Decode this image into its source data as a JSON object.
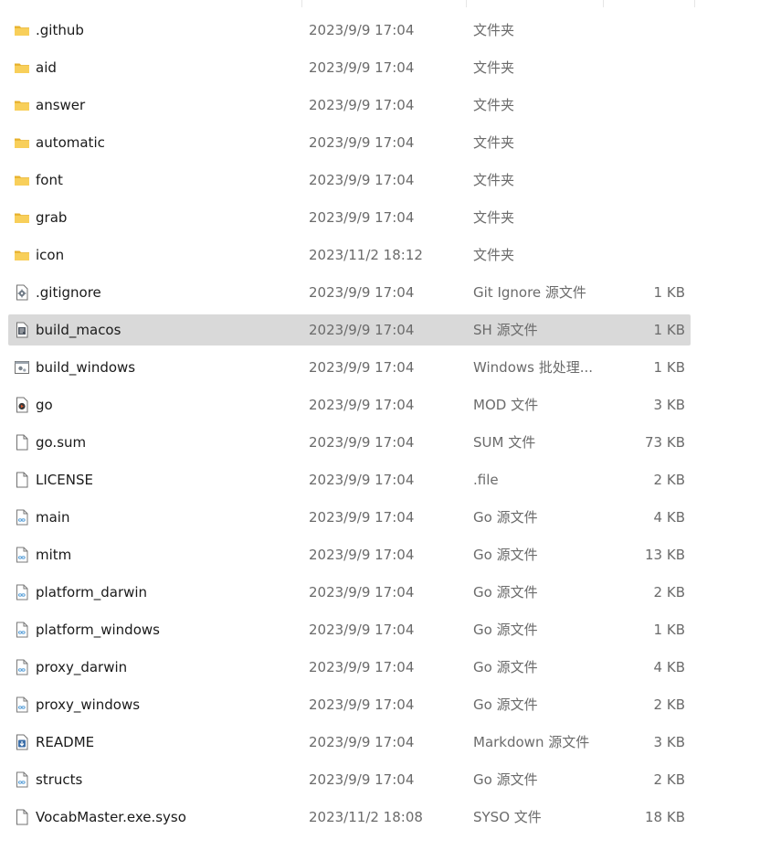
{
  "files": [
    {
      "name": ".github",
      "modified": "2023/9/9 17:04",
      "type": "文件夹",
      "size": "",
      "icon": "folder-icon",
      "selected": false
    },
    {
      "name": "aid",
      "modified": "2023/9/9 17:04",
      "type": "文件夹",
      "size": "",
      "icon": "folder-icon",
      "selected": false
    },
    {
      "name": "answer",
      "modified": "2023/9/9 17:04",
      "type": "文件夹",
      "size": "",
      "icon": "folder-icon",
      "selected": false
    },
    {
      "name": "automatic",
      "modified": "2023/9/9 17:04",
      "type": "文件夹",
      "size": "",
      "icon": "folder-icon",
      "selected": false
    },
    {
      "name": "font",
      "modified": "2023/9/9 17:04",
      "type": "文件夹",
      "size": "",
      "icon": "folder-icon",
      "selected": false
    },
    {
      "name": "grab",
      "modified": "2023/9/9 17:04",
      "type": "文件夹",
      "size": "",
      "icon": "folder-icon",
      "selected": false
    },
    {
      "name": "icon",
      "modified": "2023/11/2 18:12",
      "type": "文件夹",
      "size": "",
      "icon": "folder-icon",
      "selected": false
    },
    {
      "name": ".gitignore",
      "modified": "2023/9/9 17:04",
      "type": "Git Ignore 源文件",
      "size": "1 KB",
      "icon": "settings-file-icon",
      "selected": false
    },
    {
      "name": "build_macos",
      "modified": "2023/9/9 17:04",
      "type": "SH 源文件",
      "size": "1 KB",
      "icon": "script-file-icon",
      "selected": true
    },
    {
      "name": "build_windows",
      "modified": "2023/9/9 17:04",
      "type": "Windows 批处理...",
      "size": "1 KB",
      "icon": "batch-file-icon",
      "selected": false
    },
    {
      "name": "go",
      "modified": "2023/9/9 17:04",
      "type": "MOD 文件",
      "size": "3 KB",
      "icon": "media-file-icon",
      "selected": false
    },
    {
      "name": "go.sum",
      "modified": "2023/9/9 17:04",
      "type": "SUM 文件",
      "size": "73 KB",
      "icon": "blank-file-icon",
      "selected": false
    },
    {
      "name": "LICENSE",
      "modified": "2023/9/9 17:04",
      "type": ".file",
      "size": "2 KB",
      "icon": "blank-file-icon",
      "selected": false
    },
    {
      "name": "main",
      "modified": "2023/9/9 17:04",
      "type": "Go 源文件",
      "size": "4 KB",
      "icon": "go-file-icon",
      "selected": false
    },
    {
      "name": "mitm",
      "modified": "2023/9/9 17:04",
      "type": "Go 源文件",
      "size": "13 KB",
      "icon": "go-file-icon",
      "selected": false
    },
    {
      "name": "platform_darwin",
      "modified": "2023/9/9 17:04",
      "type": "Go 源文件",
      "size": "2 KB",
      "icon": "go-file-icon",
      "selected": false
    },
    {
      "name": "platform_windows",
      "modified": "2023/9/9 17:04",
      "type": "Go 源文件",
      "size": "1 KB",
      "icon": "go-file-icon",
      "selected": false
    },
    {
      "name": "proxy_darwin",
      "modified": "2023/9/9 17:04",
      "type": "Go 源文件",
      "size": "4 KB",
      "icon": "go-file-icon",
      "selected": false
    },
    {
      "name": "proxy_windows",
      "modified": "2023/9/9 17:04",
      "type": "Go 源文件",
      "size": "2 KB",
      "icon": "go-file-icon",
      "selected": false
    },
    {
      "name": "README",
      "modified": "2023/9/9 17:04",
      "type": "Markdown 源文件",
      "size": "3 KB",
      "icon": "markdown-file-icon",
      "selected": false
    },
    {
      "name": "structs",
      "modified": "2023/9/9 17:04",
      "type": "Go 源文件",
      "size": "2 KB",
      "icon": "go-file-icon",
      "selected": false
    },
    {
      "name": "VocabMaster.exe.syso",
      "modified": "2023/11/2 18:08",
      "type": "SYSO 文件",
      "size": "18 KB",
      "icon": "blank-file-icon",
      "selected": false
    }
  ],
  "colors": {
    "selection": "#d9d9d9",
    "folder": "#f5c542",
    "go_accent": "#5aa0d8",
    "secondary_text": "#6b6b6b"
  }
}
